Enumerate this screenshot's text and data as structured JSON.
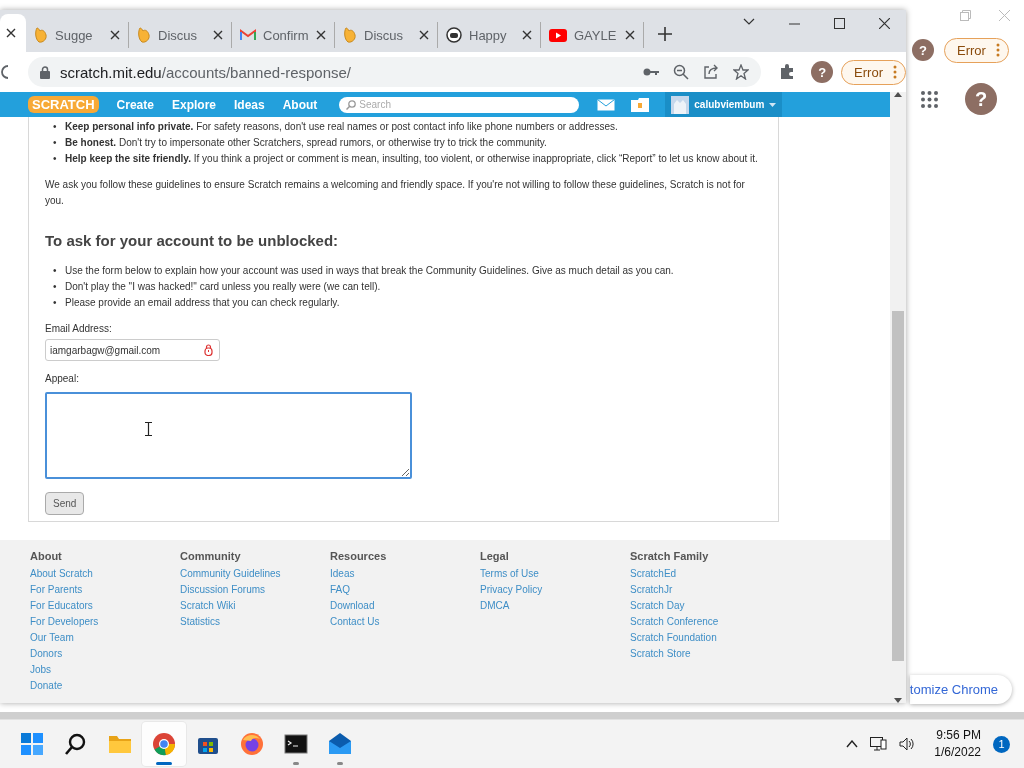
{
  "browser": {
    "tabs": [
      {
        "kind": "blank",
        "selected": true
      },
      {
        "kind": "scratch",
        "title": "Sugge",
        "selected": false
      },
      {
        "kind": "scratch",
        "title": "Discus",
        "selected": false
      },
      {
        "kind": "gmail",
        "title": "Confirm",
        "selected": false
      },
      {
        "kind": "scratch",
        "title": "Discus",
        "selected": false
      },
      {
        "kind": "robot",
        "title": "Happy",
        "selected": false
      },
      {
        "kind": "youtube",
        "title": "GAYLE",
        "selected": false
      }
    ],
    "url_host": "scratch.mit.edu",
    "url_path": "/accounts/banned-response/",
    "profile": "?",
    "error_label": "Error"
  },
  "site_nav": {
    "logo": "SCRATCH",
    "items": [
      "Create",
      "Explore",
      "Ideas",
      "About"
    ],
    "search_placeholder": "Search",
    "username": "calubviembum"
  },
  "bullet": "•",
  "guidelines": [
    "**Keep personal info private.** For safety reasons, don't use real names or post contact info like phone numbers or addresses.",
    "**Be honest.** Don't try to impersonate other Scratchers, spread rumors, or otherwise try to trick the community.",
    "**Help keep the site friendly.** If you think a project or comment is mean, insulting, too violent, or otherwise inappropriate, click “Report” to let us know about it."
  ],
  "note": "We ask you follow these guidelines to ensure Scratch remains a welcoming and friendly space. If you're not willing to follow these guidelines, Scratch is not for you.",
  "heading": "To ask for your account to be unblocked:",
  "steps": [
    "Use the form below to explain how your account was used in ways that break the Community Guidelines. Give as much detail as you can.",
    "Don't play the \"I was hacked!\" card unless you really were (we can tell).",
    "Please provide an email address that you can check regularly."
  ],
  "form": {
    "email_label": "Email Address:",
    "email_value": "iamgarbagw@gmail.com",
    "appeal_label": "Appeal:",
    "send": "Send"
  },
  "footer": [
    {
      "heading": "About",
      "links": [
        "About Scratch",
        "For Parents",
        "For Educators",
        "For Developers",
        "Our Team",
        "Donors",
        "Jobs",
        "Donate"
      ]
    },
    {
      "heading": "Community",
      "links": [
        "Community Guidelines",
        "Discussion Forums",
        "Scratch Wiki",
        "Statistics"
      ]
    },
    {
      "heading": "Resources",
      "links": [
        "Ideas",
        "FAQ",
        "Download",
        "Contact Us"
      ]
    },
    {
      "heading": "Legal",
      "links": [
        "Terms of Use",
        "Privacy Policy",
        "DMCA"
      ]
    },
    {
      "heading": "Scratch Family",
      "links": [
        "ScratchEd",
        "ScratchJr",
        "Scratch Day",
        "Scratch Conference",
        "Scratch Foundation",
        "Scratch Store"
      ]
    }
  ],
  "background_window": {
    "profile": "?",
    "error_label": "Error",
    "account": "?",
    "customize": "tomize Chrome"
  },
  "taskbar": {
    "apps": [
      {
        "kind": "start",
        "active": false,
        "running": false
      },
      {
        "kind": "search",
        "active": false,
        "running": false
      },
      {
        "kind": "folder",
        "active": false,
        "running": false
      },
      {
        "kind": "chrome",
        "active": true,
        "running": true
      },
      {
        "kind": "store",
        "active": false,
        "running": false
      },
      {
        "kind": "firefox",
        "active": false,
        "running": false
      },
      {
        "kind": "terminal",
        "active": false,
        "running": true
      },
      {
        "kind": "mail",
        "active": false,
        "running": true
      }
    ],
    "time": "9:56 PM",
    "date": "1/6/2022",
    "notifications": "1"
  }
}
